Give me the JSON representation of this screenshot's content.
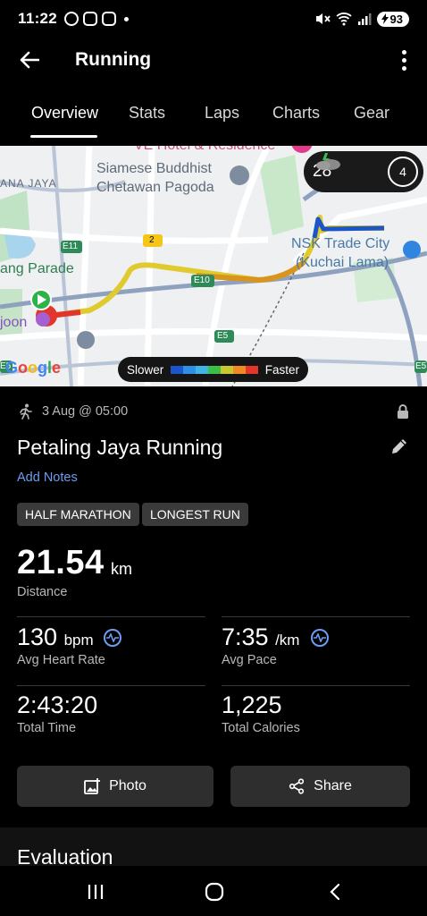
{
  "status_bar": {
    "time": "11:22",
    "battery": "93"
  },
  "app_bar": {
    "title": "Running"
  },
  "tabs": [
    {
      "label": "Overview",
      "active": true
    },
    {
      "label": "Stats"
    },
    {
      "label": "Laps"
    },
    {
      "label": "Charts"
    },
    {
      "label": "Gear"
    }
  ],
  "map": {
    "labels": {
      "hotel": "VE Hotel & Residence",
      "pagoda_1": "Siamese Buddhist",
      "pagoda_2": "Chetawan Pagoda",
      "area": "ANA JAYA",
      "parade": "ang Parade",
      "joon": "joon",
      "nsk_1": "NSK Trade City",
      "nsk_2": "(Kuchai Lama)",
      "road_e11": "E11",
      "road_2": "2",
      "road_e10": "E10",
      "road_e5": "E5",
      "road_e5b": "E5",
      "road_e5c": "E5"
    },
    "weather": {
      "temp": "28°",
      "count": "4"
    },
    "legend": {
      "slower": "Slower",
      "faster": "Faster",
      "colors": [
        "#1a56c9",
        "#2f8fe0",
        "#41b4e6",
        "#3cbf4a",
        "#c9c82e",
        "#f08a24",
        "#e2352b"
      ]
    },
    "google": "Google"
  },
  "activity": {
    "date": "3 Aug @ 05:00",
    "title": "Petaling Jaya Running",
    "add_notes": "Add Notes",
    "badges": [
      "HALF MARATHON",
      "LONGEST RUN"
    ]
  },
  "stats": {
    "distance": {
      "value": "21.54",
      "unit": "km",
      "label": "Distance"
    },
    "heart_rate": {
      "value": "130",
      "unit": "bpm",
      "label": "Avg Heart Rate"
    },
    "pace": {
      "value": "7:35",
      "unit": "/km",
      "label": "Avg Pace"
    },
    "time": {
      "value": "2:43:20",
      "label": "Total Time"
    },
    "calories": {
      "value": "1,225",
      "label": "Total Calories"
    }
  },
  "actions": {
    "photo": "Photo",
    "share": "Share"
  },
  "evaluation": {
    "title": "Evaluation"
  }
}
